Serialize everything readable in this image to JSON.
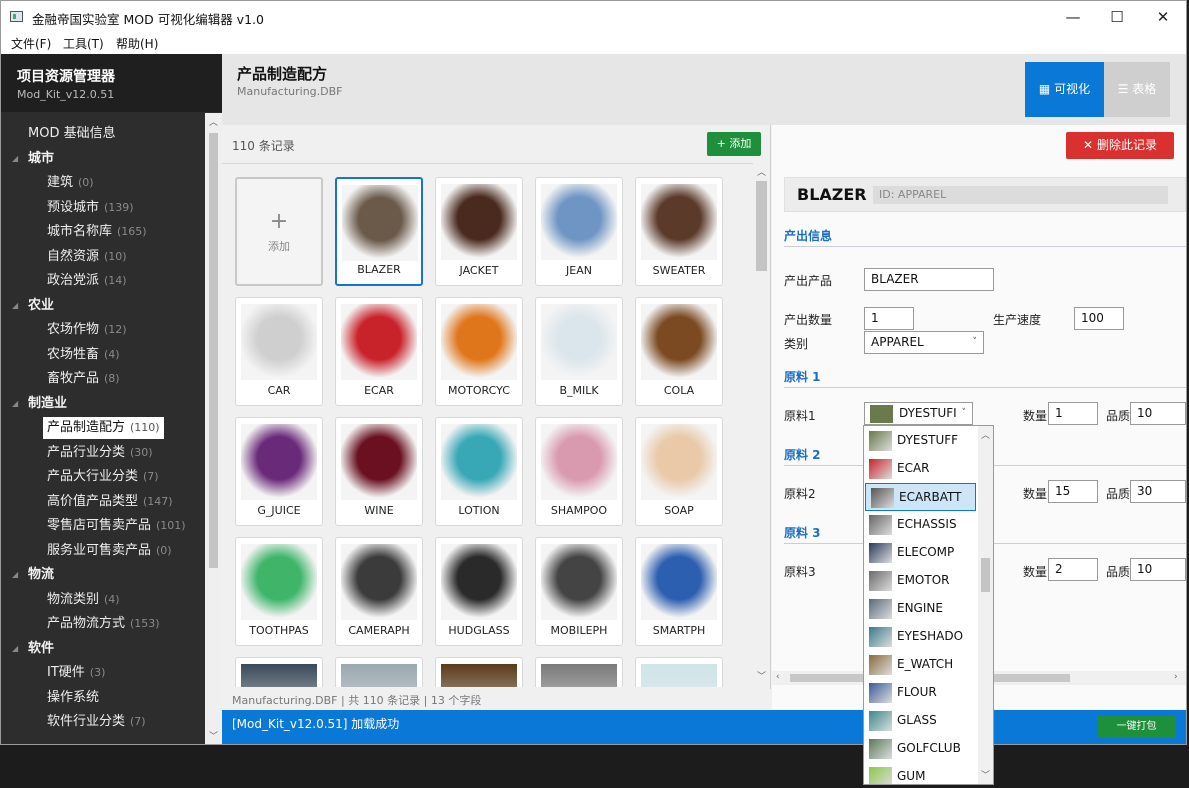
{
  "window": {
    "title": "金融帝国实验室 MOD 可视化编辑器 v1.0",
    "minimize": "—",
    "maximize": "☐",
    "close": "✕"
  },
  "menu": [
    "文件(F)",
    "工具(T)",
    "帮助(H)"
  ],
  "sidebar": {
    "title": "项目资源管理器",
    "subtitle": "Mod_Kit_v12.0.51",
    "items": [
      {
        "label": "MOD 基础信息",
        "count": "",
        "type": "root"
      },
      {
        "label": "城市",
        "count": "",
        "type": "cat"
      },
      {
        "label": "建筑",
        "count": "(0)",
        "type": "sub"
      },
      {
        "label": "预设城市",
        "count": "(139)",
        "type": "sub"
      },
      {
        "label": "城市名称库",
        "count": "(165)",
        "type": "sub"
      },
      {
        "label": "自然资源",
        "count": "(10)",
        "type": "sub"
      },
      {
        "label": "政治党派",
        "count": "(14)",
        "type": "sub"
      },
      {
        "label": "农业",
        "count": "",
        "type": "cat"
      },
      {
        "label": "农场作物",
        "count": "(12)",
        "type": "sub"
      },
      {
        "label": "农场牲畜",
        "count": "(4)",
        "type": "sub"
      },
      {
        "label": "畜牧产品",
        "count": "(8)",
        "type": "sub"
      },
      {
        "label": "制造业",
        "count": "",
        "type": "cat"
      },
      {
        "label": "产品制造配方",
        "count": "(110)",
        "type": "sub",
        "selected": true
      },
      {
        "label": "产品行业分类",
        "count": "(30)",
        "type": "sub"
      },
      {
        "label": "产品大行业分类",
        "count": "(7)",
        "type": "sub"
      },
      {
        "label": "高价值产品类型",
        "count": "(147)",
        "type": "sub"
      },
      {
        "label": "零售店可售卖产品",
        "count": "(101)",
        "type": "sub"
      },
      {
        "label": "服务业可售卖产品",
        "count": "(0)",
        "type": "sub"
      },
      {
        "label": "物流",
        "count": "",
        "type": "cat"
      },
      {
        "label": "物流类别",
        "count": "(4)",
        "type": "sub"
      },
      {
        "label": "产品物流方式",
        "count": "(153)",
        "type": "sub"
      },
      {
        "label": "软件",
        "count": "",
        "type": "cat"
      },
      {
        "label": "IT硬件",
        "count": "(3)",
        "type": "sub"
      },
      {
        "label": "操作系统",
        "count": "",
        "type": "sub"
      },
      {
        "label": "软件行业分类",
        "count": "(7)",
        "type": "sub"
      }
    ]
  },
  "header": {
    "title": "产品制造配方",
    "subtitle": "Manufacturing.DBF",
    "btn_visual": "▦ 可视化",
    "btn_table": "☰ 表格"
  },
  "grid": {
    "record_count": "110  条记录",
    "add_button": "+ 添加",
    "add_card_label": "添加",
    "add_card_plus": "+",
    "items": [
      {
        "label": "BLAZER",
        "color": "#6b5a4a",
        "selected": true
      },
      {
        "label": "JACKET",
        "color": "#4a2a1e"
      },
      {
        "label": "JEAN",
        "color": "#6f95c4"
      },
      {
        "label": "SWEATER",
        "color": "#5b3a2a"
      },
      {
        "label": "CAR",
        "color": "#cfcfcf"
      },
      {
        "label": "ECAR",
        "color": "#c8232a"
      },
      {
        "label": "MOTORCYC",
        "color": "#e0761c"
      },
      {
        "label": "B_MILK",
        "color": "#dbe6ec"
      },
      {
        "label": "COLA",
        "color": "#7b4a22"
      },
      {
        "label": "G_JUICE",
        "color": "#6a2a7a"
      },
      {
        "label": "WINE",
        "color": "#6a1020"
      },
      {
        "label": "LOTION",
        "color": "#38a7b6"
      },
      {
        "label": "SHAMPOO",
        "color": "#d99ab0"
      },
      {
        "label": "SOAP",
        "color": "#e9c9a8"
      },
      {
        "label": "TOOTHPAS",
        "color": "#3fb56a"
      },
      {
        "label": "CAMERAPH",
        "color": "#3b3b3b"
      },
      {
        "label": "HUDGLASS",
        "color": "#2a2a2a"
      },
      {
        "label": "MOBILEPH",
        "color": "#444444"
      },
      {
        "label": "SMARTPH",
        "color": "#2d5fb0"
      }
    ],
    "partial_colors": [
      "#3a4a5a",
      "#9aa8b0",
      "#5a3a1a",
      "#7a7a7a",
      "#cfe5ea"
    ],
    "status": "Manufacturing.DBF | 共 110 条记录 | 13 个字段"
  },
  "detail": {
    "delete_button": "删除此记录",
    "delete_icon": "✕",
    "name": "BLAZER",
    "id": "ID: APPAREL",
    "section_output": "产出信息",
    "label_product": "产出产品",
    "product": "BLAZER",
    "label_qty": "产出数量",
    "qty": "1",
    "label_speed": "生产速度",
    "speed": "100",
    "label_category": "类别",
    "category": "APPAREL",
    "section_m1": "原料 1",
    "label_m1": "原料1",
    "m1_value": "DYESTUFI",
    "label_m1_qty": "数量",
    "m1_qty": "1",
    "label_m1_quality": "品质",
    "m1_quality": "10",
    "section_m2": "原料 2",
    "label_m2": "原料2",
    "label_m2_qty": "数量",
    "m2_qty": "15",
    "label_m2_quality": "品质",
    "m2_quality": "30",
    "section_m3": "原料 3",
    "label_m3": "原料3",
    "label_m3_qty": "数量",
    "m3_qty": "2",
    "label_m3_quality": "品质",
    "m3_quality": "10"
  },
  "dropdown": {
    "items": [
      {
        "label": "DYESTUFF",
        "color": "#6a7a4a"
      },
      {
        "label": "ECAR",
        "color": "#c8232a"
      },
      {
        "label": "ECARBATT",
        "color": "#555555",
        "highlighted": true
      },
      {
        "label": "ECHASSIS",
        "color": "#666666"
      },
      {
        "label": "ELECOMP",
        "color": "#2a3a5a"
      },
      {
        "label": "EMOTOR",
        "color": "#6a6a6a"
      },
      {
        "label": "ENGINE",
        "color": "#5a6a7a"
      },
      {
        "label": "EYESHADO",
        "color": "#3a7a8a"
      },
      {
        "label": "E_WATCH",
        "color": "#8a6a3a"
      },
      {
        "label": "FLOUR",
        "color": "#3a5a9a"
      },
      {
        "label": "GLASS",
        "color": "#3a8a8a"
      },
      {
        "label": "GOLFCLUB",
        "color": "#5a7a5a"
      },
      {
        "label": "GUM",
        "color": "#8ac84a"
      }
    ]
  },
  "statusbar": {
    "message": "[Mod_Kit_v12.0.51] 加载成功",
    "pack_button": "一键打包"
  }
}
